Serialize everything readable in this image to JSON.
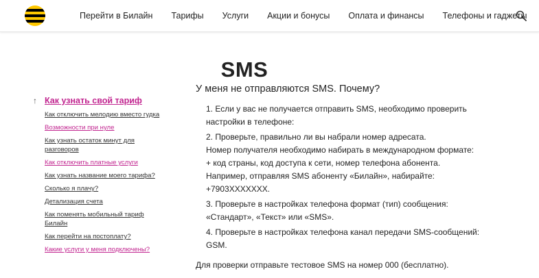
{
  "header": {
    "nav": [
      "Перейти в Билайн",
      "Тарифы",
      "Услуги",
      "Акции и бонусы",
      "Оплата и финансы",
      "Телефоны и гаджеты"
    ]
  },
  "page": {
    "title": "SMS"
  },
  "sidebar": {
    "current": "Как узнать свой тариф",
    "items": [
      {
        "label": "Как отключить мелодию вместо гудка",
        "color": "#333333"
      },
      {
        "label": "Возможности при нуле",
        "color": "#c1248f"
      },
      {
        "label": "Как узнать остаток минут для разговоров",
        "color": "#333333"
      },
      {
        "label": "Как отключить платные услуги",
        "color": "#c1248f"
      },
      {
        "label": "Как узнать название моего тарифа?",
        "color": "#333333"
      },
      {
        "label": "Сколько я плачу?",
        "color": "#333333"
      },
      {
        "label": "Детализация счета",
        "color": "#333333"
      },
      {
        "label": "Как поменять мобильный тариф Билайн",
        "color": "#333333"
      },
      {
        "label": "Как перейти на постоплату?",
        "color": "#333333"
      },
      {
        "label": "Какие услуги у меня подключены?",
        "color": "#c1248f"
      }
    ]
  },
  "content": {
    "question": "У меня не отправляются SMS. Почему?",
    "step1": "1. Если у вас не получается отправить SMS, необходимо проверить настройки в телефоне:",
    "step2": "2. Проверьте, правильно ли вы набрали номер адресата.",
    "step2_line2": "Номер получателя необходимо набирать в международном формате:",
    "step2_line3": "+ код страны, код доступа к сети, номер телефона абонента.",
    "step2_line4": "Например, отправляя SMS абоненту «Билайн», набирайте:",
    "step2_line5": "+7903XXXXXXX.",
    "step3": "3. Проверьте в настройках телефона формат (тип) сообщения: «Стандарт», «Текст» или «SMS».",
    "step4": "4. Проверьте в настройках телефона канал передачи SMS-сообщений: GSM.",
    "note": "Для проверки отправьте тестовое SMS на номер 000 (бесплатно)."
  },
  "colors": {
    "accent": "#c1248f",
    "logo_yellow": "#ffc800",
    "logo_black": "#000000"
  },
  "icons": {
    "logo": "beeline-logo",
    "search": "search-icon",
    "back": "arrow-up-icon"
  }
}
